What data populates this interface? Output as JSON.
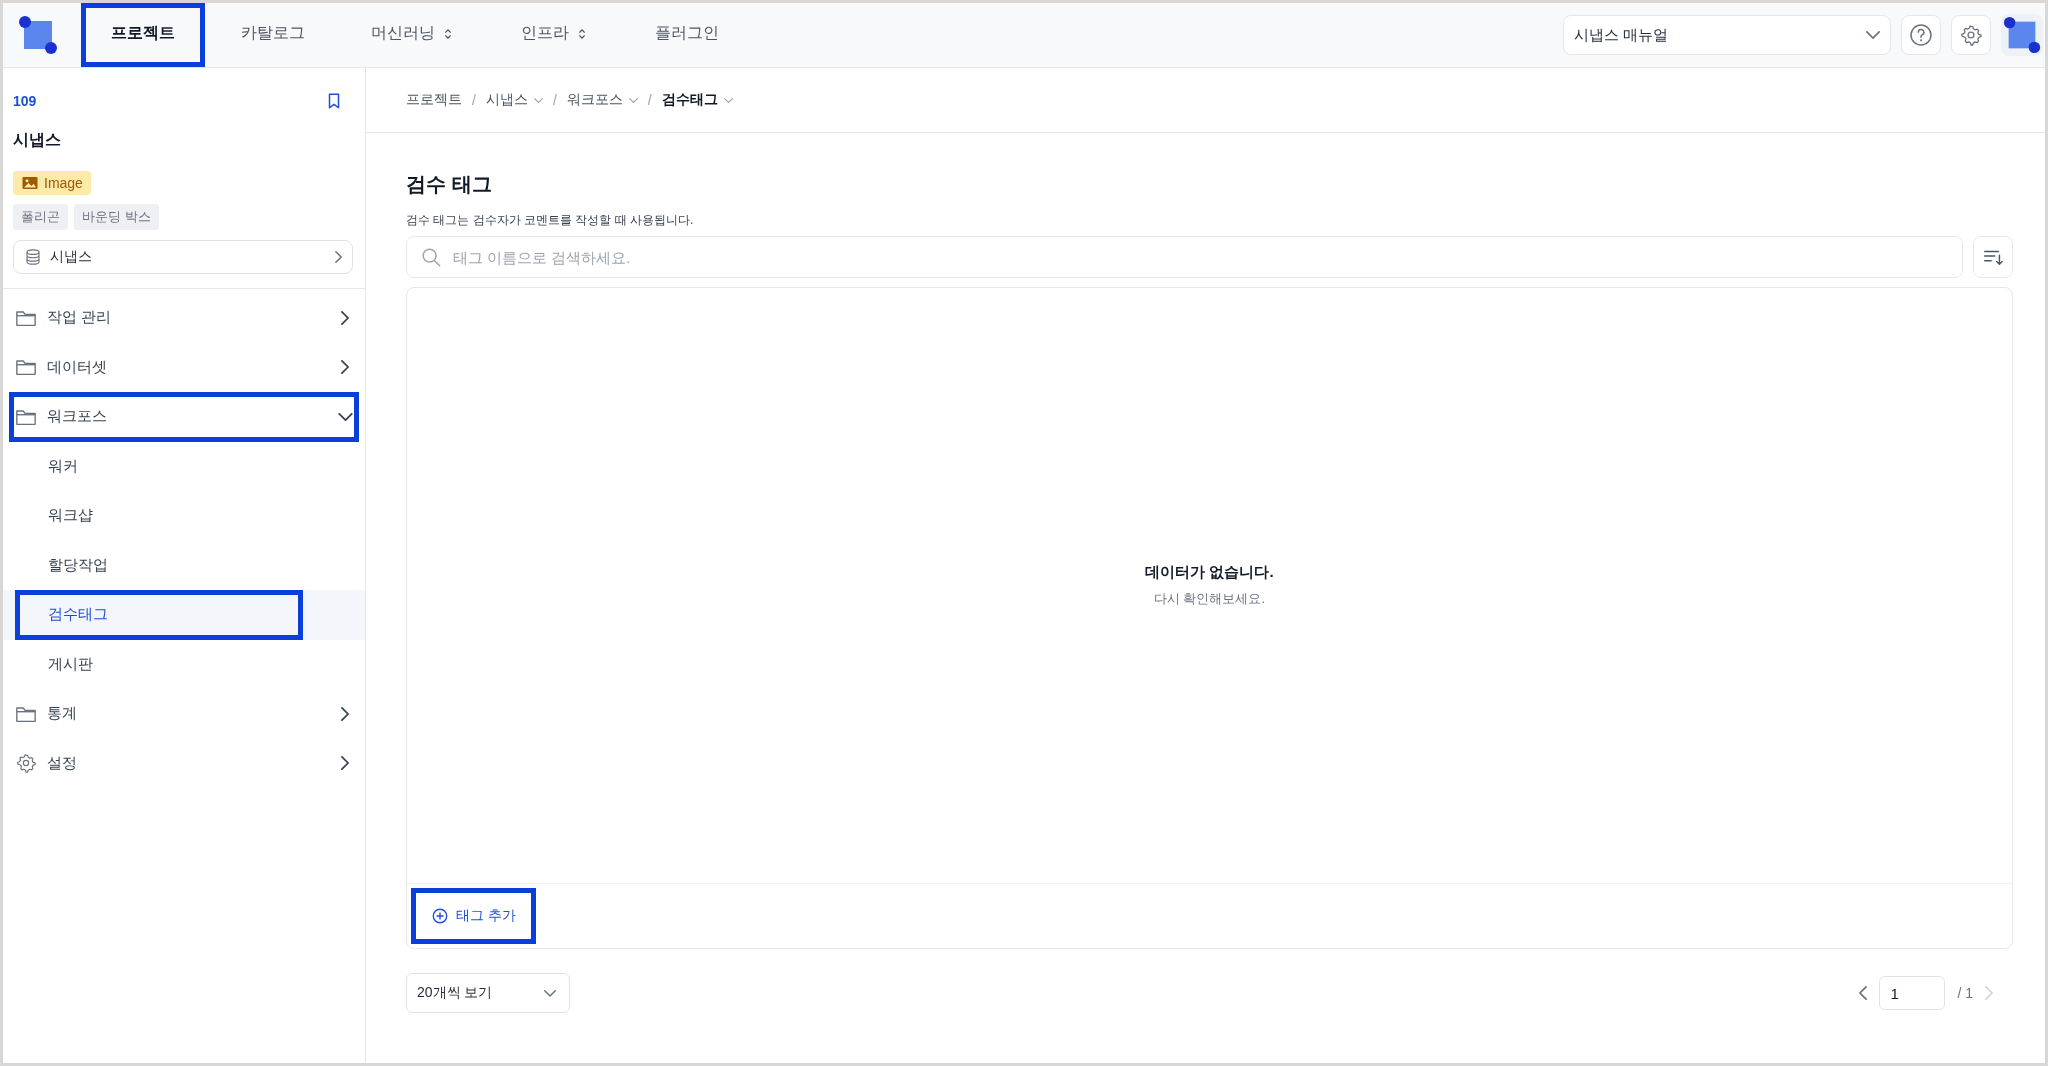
{
  "topbar": {
    "tabs": [
      {
        "label": "프로젝트",
        "kind": "link",
        "selected": true,
        "highlighted": true
      },
      {
        "label": "카탈로그",
        "kind": "link",
        "selected": false,
        "highlighted": false
      },
      {
        "label": "머신러닝",
        "kind": "dropdown",
        "selected": false,
        "highlighted": false
      },
      {
        "label": "인프라",
        "kind": "dropdown",
        "selected": false,
        "highlighted": false
      },
      {
        "label": "플러그인",
        "kind": "link",
        "selected": false,
        "highlighted": false
      }
    ],
    "manual_select": {
      "value": "시냅스 매뉴얼"
    }
  },
  "sidebar": {
    "project_id": "109",
    "project_name": "시냅스",
    "data_type": "Image",
    "tags": [
      "폴리곤",
      "바운딩 박스"
    ],
    "dataset_button": "시냅스",
    "menu": [
      {
        "kind": "folder",
        "label": "작업 관리",
        "expanded": false,
        "highlighted": false
      },
      {
        "kind": "folder",
        "label": "데이터셋",
        "expanded": false,
        "highlighted": false
      },
      {
        "kind": "folder",
        "label": "워크포스",
        "expanded": true,
        "highlighted": true,
        "children": [
          {
            "label": "워커",
            "selected": false,
            "highlighted": false
          },
          {
            "label": "워크샵",
            "selected": false,
            "highlighted": false
          },
          {
            "label": "할당작업",
            "selected": false,
            "highlighted": false
          },
          {
            "label": "검수태그",
            "selected": true,
            "highlighted": true
          },
          {
            "label": "게시판",
            "selected": false,
            "highlighted": false
          }
        ]
      },
      {
        "kind": "folder",
        "label": "통계",
        "expanded": false,
        "highlighted": false
      },
      {
        "kind": "settings",
        "label": "설정",
        "expanded": false,
        "highlighted": false
      }
    ]
  },
  "breadcrumb": [
    {
      "label": "프로젝트",
      "kind": "link",
      "selected": false
    },
    {
      "separator": "/",
      "label": "시냅스",
      "kind": "dropdown",
      "selected": false
    },
    {
      "separator": "/",
      "label": "워크포스",
      "kind": "dropdown",
      "selected": false
    },
    {
      "separator": "/",
      "label": "검수태그",
      "kind": "dropdown",
      "selected": true
    }
  ],
  "page": {
    "title": "검수 태그",
    "description": "검수 태그는 검수자가 코멘트를 작성할 때 사용됩니다.",
    "search": {
      "placeholder": "태그 이름으로 검색하세요."
    },
    "empty_title": "데이터가 없습니다.",
    "empty_hint": "다시 확인해보세요.",
    "add_button": {
      "label": "태그 추가",
      "highlighted": true
    }
  },
  "footer": {
    "page_size": "20개씩 보기",
    "page": "1",
    "total": "/ 1"
  }
}
